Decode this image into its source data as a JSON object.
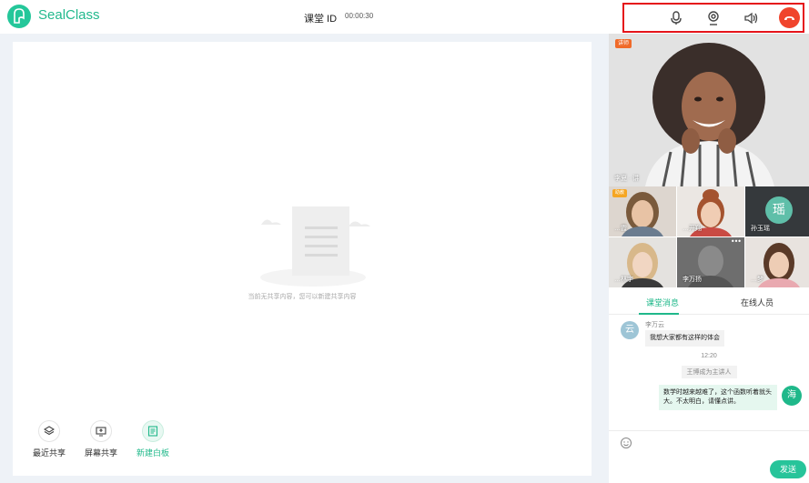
{
  "app": {
    "name": "SealClass"
  },
  "room": {
    "label": "课堂 ID",
    "timer": "00:00:30"
  },
  "controls": {
    "mic": "microphone-icon",
    "camera": "camera-icon",
    "speaker": "speaker-icon",
    "hangup": "hang-up-icon",
    "hangup_color": "#f0442c"
  },
  "whiteboard": {
    "empty_text": "当前无共享内容，您可以新建共享内容",
    "tools": [
      {
        "label": "最近共享",
        "icon": "layers-icon"
      },
      {
        "label": "屏幕共享",
        "icon": "screen-share-icon"
      },
      {
        "label": "新建白板",
        "icon": "whiteboard-icon",
        "active": true
      }
    ]
  },
  "videos": {
    "main": {
      "tag": "讲师",
      "name": "李夏 · 讲"
    },
    "thumbs": [
      {
        "name": "…霞",
        "tag": "助教"
      },
      {
        "name": "…开翔"
      },
      {
        "name": "孙玉瑶",
        "avatar": "瑶"
      },
      {
        "name": "…林宇"
      },
      {
        "name": "李万扬"
      },
      {
        "name": "…梦"
      }
    ]
  },
  "tabs": [
    {
      "label": "课堂消息",
      "active": true
    },
    {
      "label": "在线人员"
    }
  ],
  "chat": {
    "messages": [
      {
        "avatar": "云",
        "name": "李万云",
        "text": "我想大家都有这样的体会"
      },
      {
        "avatar": "海",
        "text": "数学时越来越难了，这个函数听着就头大。不太明白，请懂点讲。",
        "mine": true
      }
    ],
    "time": "12:20",
    "system": "王博成为主讲人"
  },
  "composer": {
    "emoji": "smiley-icon",
    "send_label": "发送"
  },
  "colors": {
    "accent": "#1fb88a",
    "highlight_border": "#e5141a"
  }
}
